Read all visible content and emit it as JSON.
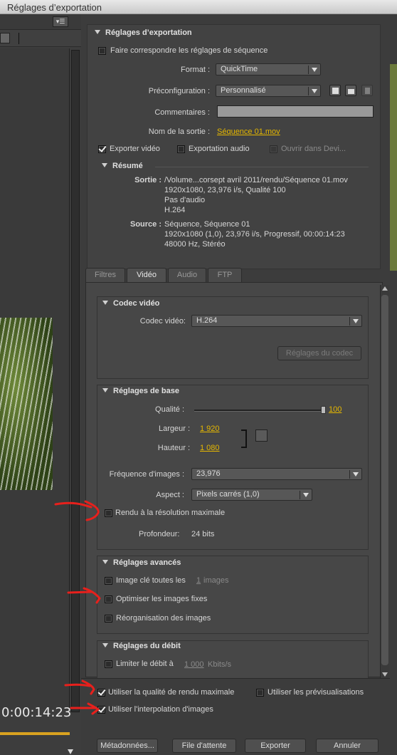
{
  "window": {
    "title": "Réglages d’exportation"
  },
  "left": {
    "timecode": "0:00:14:23",
    "menu_icon": "panel-menu-icon"
  },
  "colors": {
    "accent": "#e6b800",
    "timeline": "#d9a220",
    "annotation": "#e8201c"
  },
  "export_settings": {
    "header": "Réglages d’exportation",
    "match_sequence_label": "Faire correspondre les réglages de séquence",
    "format_label": "Format :",
    "format_value": "QuickTime",
    "preset_label": "Préconfiguration :",
    "preset_value": "Personnalisé",
    "comments_label": "Commentaires :",
    "output_name_label": "Nom de la sortie :",
    "output_name_value": "Séquence 01.mov",
    "export_video_label": "Exporter vidéo",
    "export_audio_label": "Exportation audio",
    "open_in_device_label": "Ouvrir dans Devi...",
    "summary_header": "Résumé",
    "output_label": "Sortie :",
    "output_lines": [
      "/Volume...corsept avril 2011/rendu/Séquence 01.mov",
      "1920x1080, 23,976 i/s, Qualité  100",
      "Pas d'audio",
      "H.264"
    ],
    "source_label": "Source :",
    "source_lines": [
      "Séquence, Séquence 01",
      "1920x1080 (1,0), 23,976 i/s, Progressif, 00:00:14:23",
      "48000 Hz, Stéréo"
    ]
  },
  "tabs": [
    "Filtres",
    "Vidéo",
    "Audio",
    "FTP"
  ],
  "codec": {
    "header": "Codec vidéo",
    "codec_label": "Codec vidéo:",
    "codec_value": "H.264",
    "codec_settings_button": "Réglages du codec"
  },
  "basic": {
    "header": "Réglages de base",
    "quality_label": "Qualité :",
    "quality_value": "100",
    "width_label": "Largeur :",
    "width_value": "1 920",
    "height_label": "Hauteur :",
    "height_value": "1 080",
    "framerate_label": "Fréquence d'images :",
    "framerate_value": "23,976",
    "aspect_label": "Aspect :",
    "aspect_value": "Pixels carrés (1,0)",
    "max_render_label": "Rendu à la résolution maximale",
    "depth_label": "Profondeur:",
    "depth_value": "24 bits"
  },
  "advanced": {
    "header": "Réglages avancés",
    "keyframe_label": "Image clé toutes les",
    "keyframe_value": "1",
    "keyframe_unit": "images",
    "optimize_label": "Optimiser les images fixes",
    "reorder_label": "Réorganisation des images"
  },
  "bitrate": {
    "header": "Réglages du débit",
    "limit_label": "Limiter le débit à",
    "limit_value": "1 000",
    "limit_unit": "Kbits/s"
  },
  "bottom": {
    "max_quality_label": "Utiliser la qualité de rendu maximale",
    "use_previews_label": "Utiliser les prévisualisations",
    "frame_blend_label": "Utiliser l'interpolation d'images",
    "metadata_button": "Métadonnées...",
    "queue_button": "File d'attente",
    "export_button": "Exporter",
    "cancel_button": "Annuler"
  }
}
